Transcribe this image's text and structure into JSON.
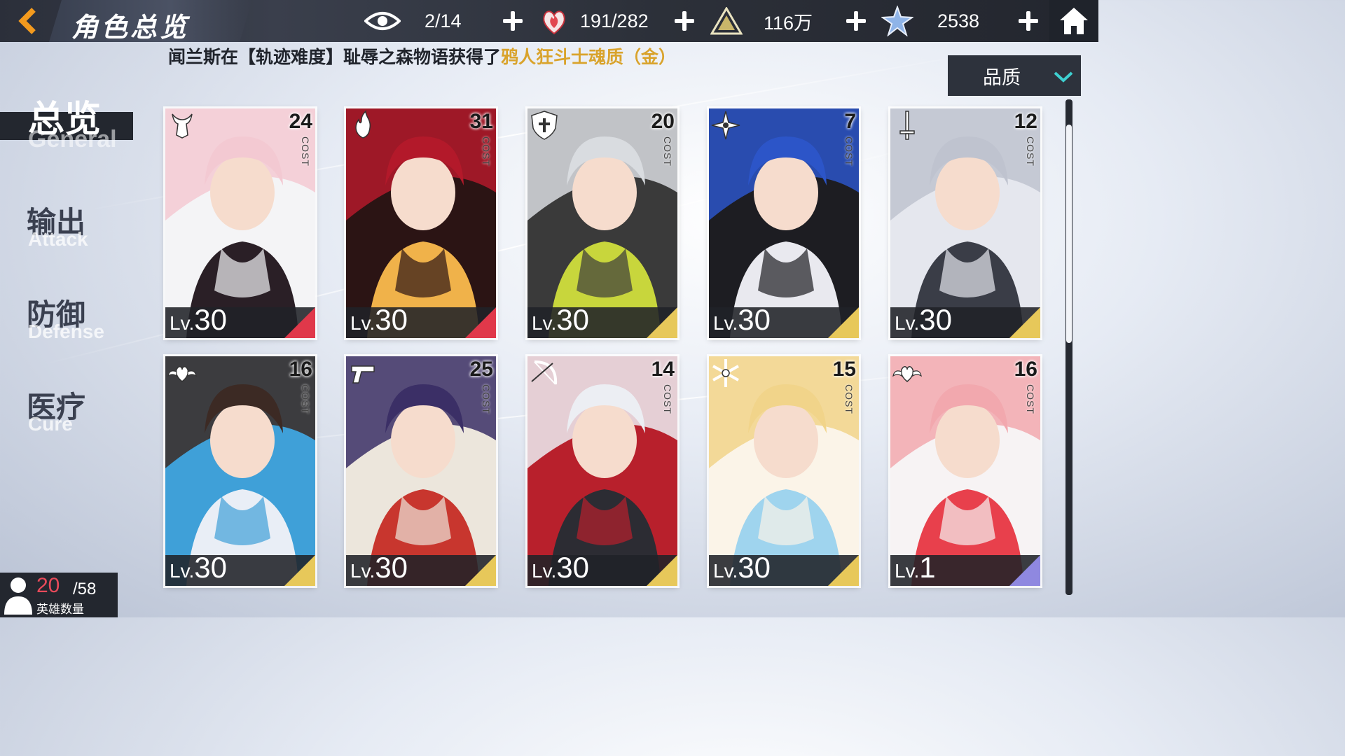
{
  "header": {
    "title": "角色总览",
    "resources": [
      {
        "icon": "eye-icon",
        "value": "2/14"
      },
      {
        "icon": "heart-flame-icon",
        "value": "191/282"
      },
      {
        "icon": "triangle-emblem-icon",
        "value": "116万"
      },
      {
        "icon": "star-crystal-icon",
        "value": "2538"
      }
    ]
  },
  "ticker": {
    "text": "闻兰斯在【轨迹难度】耻辱之森物语获得了",
    "highlight": "鸦人狂斗士魂质（金）"
  },
  "filter": {
    "selected": "品质"
  },
  "nav": [
    {
      "cn": "总览",
      "en": "General",
      "active": true
    },
    {
      "cn": "输出",
      "en": "Attack",
      "active": false
    },
    {
      "cn": "防御",
      "en": "Defense",
      "active": false
    },
    {
      "cn": "医疗",
      "en": "Cure",
      "active": false
    }
  ],
  "cards": [
    {
      "cost": "24",
      "cost_label": "COST",
      "lv_prefix": "Lv.",
      "level": "30",
      "icon": "demon-horns-icon",
      "rarity_color": "#e0384a",
      "palette": [
        "#f3c9d2",
        "#2a1f26",
        "#f4f4f6"
      ]
    },
    {
      "cost": "31",
      "cost_label": "COST",
      "lv_prefix": "Lv.",
      "level": "30",
      "icon": "flame-icon",
      "rarity_color": "#e0384a",
      "palette": [
        "#b3192a",
        "#f0b24a",
        "#2b1414"
      ]
    },
    {
      "cost": "20",
      "cost_label": "COST",
      "lv_prefix": "Lv.",
      "level": "30",
      "icon": "shield-cross-icon",
      "rarity_color": "#e7c85a",
      "palette": [
        "#d9dce0",
        "#c8d63c",
        "#3a3a3a"
      ]
    },
    {
      "cost": "7",
      "cost_label": "COST",
      "lv_prefix": "Lv.",
      "level": "30",
      "icon": "shuriken-icon",
      "rarity_color": "#e7c85a",
      "palette": [
        "#2c55c8",
        "#e9e9ef",
        "#1d1d22"
      ]
    },
    {
      "cost": "12",
      "cost_label": "COST",
      "lv_prefix": "Lv.",
      "level": "30",
      "icon": "sword-icon",
      "rarity_color": "#e7c85a",
      "palette": [
        "#bfc3cf",
        "#3a3d47",
        "#e5e7ee"
      ]
    },
    {
      "cost": "16",
      "cost_label": "COST",
      "lv_prefix": "Lv.",
      "level": "30",
      "icon": "winged-heart-icon",
      "rarity_color": "#e7c85a",
      "palette": [
        "#3c2a24",
        "#e9eef6",
        "#3fa0d8"
      ]
    },
    {
      "cost": "25",
      "cost_label": "COST",
      "lv_prefix": "Lv.",
      "level": "30",
      "icon": "revolver-icon",
      "rarity_color": "#e7c85a",
      "palette": [
        "#3b2f66",
        "#c8362e",
        "#ece6dc"
      ]
    },
    {
      "cost": "14",
      "cost_label": "COST",
      "lv_prefix": "Lv.",
      "level": "30",
      "icon": "bow-icon",
      "rarity_color": "#e7c85a",
      "palette": [
        "#eceef3",
        "#2c2c33",
        "#b8202c"
      ]
    },
    {
      "cost": "15",
      "cost_label": "COST",
      "lv_prefix": "Lv.",
      "level": "30",
      "icon": "snowflake-icon",
      "rarity_color": "#e7c85a",
      "palette": [
        "#f1d48a",
        "#9fd4ee",
        "#fbf4e8"
      ]
    },
    {
      "cost": "16",
      "cost_label": "COST",
      "lv_prefix": "Lv.",
      "level": "1",
      "icon": "winged-heart-icon",
      "rarity_color": "#8f88e0",
      "palette": [
        "#f2a8ae",
        "#e8404c",
        "#f7f3f4"
      ]
    }
  ],
  "hero_count": {
    "current": "20",
    "max": "/58",
    "label": "英雄数量"
  }
}
